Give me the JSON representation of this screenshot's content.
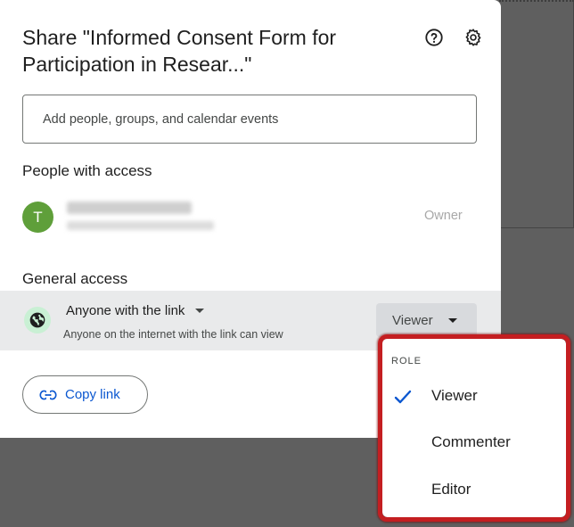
{
  "dialog": {
    "title_line1": "Share \"Informed Consent Form for",
    "title_line2": "Participation in Resear...\"",
    "help_icon": "help-circle-icon",
    "settings_icon": "gear-icon",
    "add_placeholder": "Add people, groups, and calendar events",
    "people_heading": "People with access",
    "owner": {
      "avatar_initial": "T",
      "avatar_color": "#5f9f3a",
      "role": "Owner"
    },
    "general_access_heading": "General access",
    "access": {
      "title": "Anyone with the link",
      "description": "Anyone on the internet with the link can view",
      "role_button": "Viewer",
      "icon": "globe-icon"
    },
    "copy_link_label": "Copy link",
    "copy_link_icon": "link-icon"
  },
  "role_menu": {
    "heading": "ROLE",
    "items": [
      {
        "label": "Viewer",
        "selected": true
      },
      {
        "label": "Commenter",
        "selected": false
      },
      {
        "label": "Editor",
        "selected": false
      }
    ],
    "highlight_color": "#c41e21"
  },
  "colors": {
    "accent": "#0b57d0",
    "backdrop": "#5f5f5f"
  }
}
